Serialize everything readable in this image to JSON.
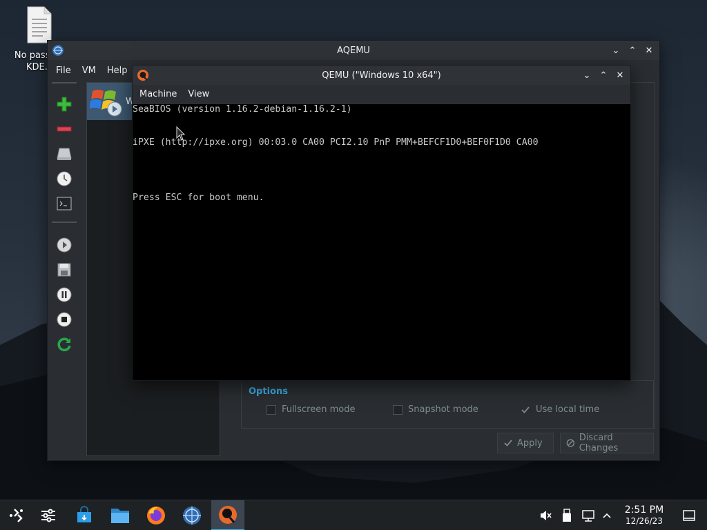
{
  "desktop": {
    "icon_label_line1": "No passwo",
    "icon_label_line2": "KDE.t"
  },
  "aqemu": {
    "title": "AQEMU",
    "menu": [
      "File",
      "VM",
      "Help"
    ],
    "vm_item_label": "W",
    "options": {
      "title": "Options",
      "fullscreen_label": "Fullscreen mode",
      "snapshot_label": "Snapshot mode",
      "localtime_label": "Use local time"
    },
    "apply_label": "Apply",
    "discard_label": "Discard Changes"
  },
  "qemu": {
    "title": "QEMU (\"Windows 10 x64\")",
    "menu": [
      "Machine",
      "View"
    ],
    "console_lines": [
      "SeaBIOS (version 1.16.2-debian-1.16.2-1)",
      "iPXE (http://ipxe.org) 00:03.0 CA00 PCI2.10 PnP PMM+BEFCF1D0+BEF0F1D0 CA00",
      "Press ESC for boot menu."
    ]
  },
  "taskbar": {
    "apps": [
      "application-launcher-icon",
      "system-settings-icon",
      "discover-store-icon",
      "file-manager-icon",
      "firefox-icon",
      "aqemu-icon",
      "qemu-icon"
    ],
    "time": "2:51 PM",
    "date": "12/26/23"
  },
  "colors": {
    "accent": "#3daee9",
    "window_bg": "#2a2e32",
    "add_green": "#3dbb3d",
    "remove_red": "#da4453"
  }
}
